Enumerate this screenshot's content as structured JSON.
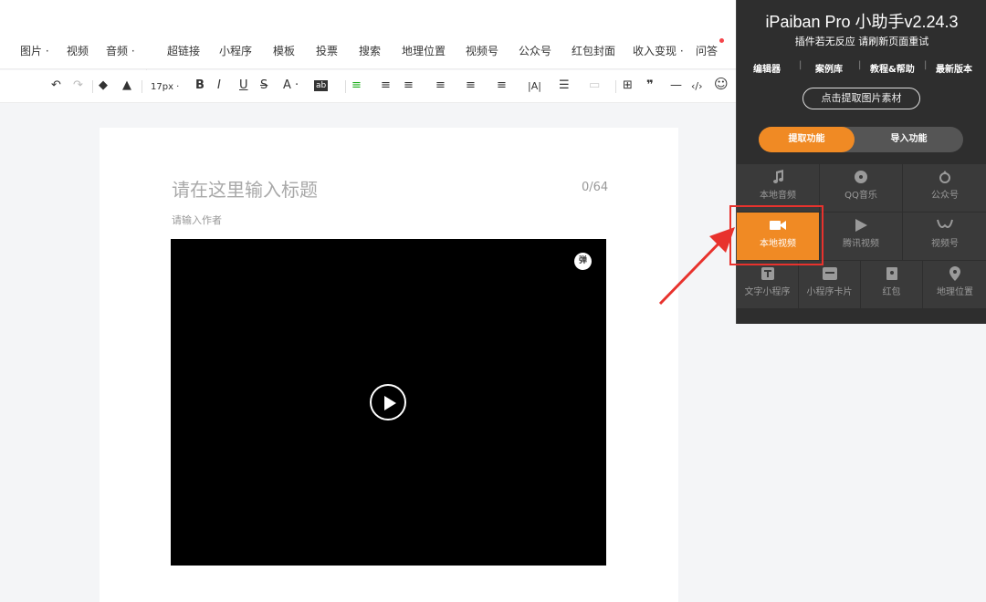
{
  "menu": {
    "items": [
      "图片",
      "视频",
      "音频",
      "超链接",
      "小程序",
      "模板",
      "投票",
      "搜索",
      "地理位置",
      "视频号",
      "公众号",
      "红包封面",
      "收入变现",
      "问答"
    ],
    "caret": "·"
  },
  "toolbar": {
    "font_size": "17px",
    "bold": "B",
    "italic": "I",
    "underline": "U",
    "strike": "S",
    "font_color": "A",
    "bg_color_label": "ab",
    "letter_spacing": "|A|",
    "quote": "❞",
    "hr": "—",
    "code": "‹/›",
    "emoji": "☺"
  },
  "editor": {
    "title_placeholder": "请在这里输入标题",
    "title_count": "0/64",
    "author_placeholder": "请输入作者",
    "danmu_icon_text": "弹"
  },
  "panel": {
    "title": "iPaiban Pro 小助手v2.24.3",
    "subtitle": "插件若无反应 请刷新页面重试",
    "links": [
      "编辑器",
      "案例库",
      "教程&帮助",
      "最新版本"
    ],
    "divider": "|",
    "extract_button": "点击提取图片素材",
    "tabs": {
      "extract": "提取功能",
      "import": "导入功能"
    },
    "grid": [
      {
        "label": "本地音频",
        "icon": "music-note-icon"
      },
      {
        "label": "QQ音乐",
        "icon": "qq-music-icon"
      },
      {
        "label": "公众号",
        "icon": "wechat-official-icon"
      },
      {
        "label": "本地视频",
        "icon": "video-camera-icon",
        "active": true
      },
      {
        "label": "腾讯视频",
        "icon": "tencent-video-icon"
      },
      {
        "label": "视频号",
        "icon": "channels-icon"
      },
      {
        "label": "文字小程序",
        "icon": "text-t-icon"
      },
      {
        "label": "小程序卡片",
        "icon": "card-icon"
      },
      {
        "label": "红包",
        "icon": "red-packet-icon"
      },
      {
        "label": "地理位置",
        "icon": "location-pin-icon"
      }
    ]
  },
  "colors": {
    "accent": "#f08a24",
    "panel_bg": "#2e2e2e",
    "highlight": "#e8322d",
    "active_align": "#1aad19"
  }
}
